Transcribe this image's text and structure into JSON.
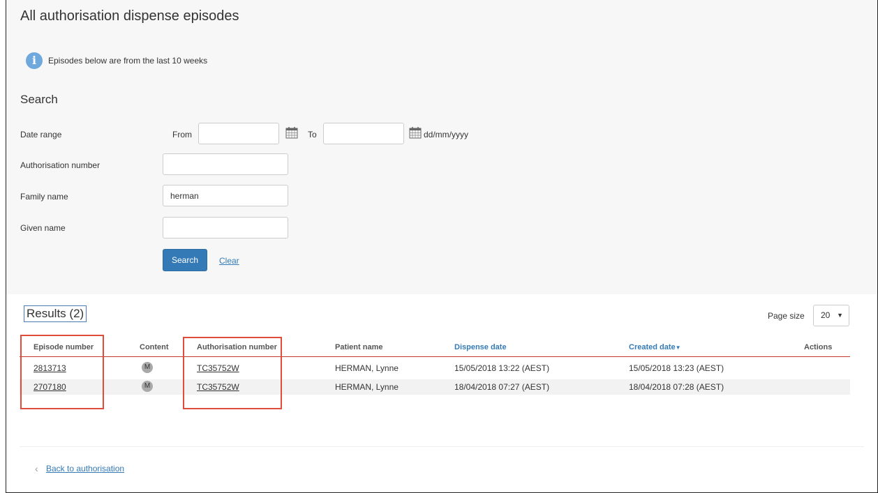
{
  "page": {
    "title": "All authorisation dispense episodes",
    "info_text": "Episodes below are from the last 10 weeks"
  },
  "search": {
    "title": "Search",
    "date_range_label": "Date range",
    "from_label": "From",
    "to_label": "To",
    "date_format_hint": "dd/mm/yyyy",
    "from_value": "",
    "to_value": "",
    "authorisation_number_label": "Authorisation number",
    "authorisation_number_value": "",
    "family_name_label": "Family name",
    "family_name_value": "herman",
    "given_name_label": "Given name",
    "given_name_value": "",
    "search_button_label": "Search",
    "clear_link_label": "Clear"
  },
  "results": {
    "title": "Results (2)",
    "page_size_label": "Page size",
    "page_size_value": "20",
    "columns": {
      "episode_number": "Episode number",
      "content": "Content",
      "authorisation_number": "Authorisation number",
      "patient_name": "Patient name",
      "dispense_date": "Dispense date",
      "created_date": "Created date",
      "actions": "Actions"
    },
    "rows": [
      {
        "episode_number": "2813713",
        "content": "M",
        "authorisation_number": "TC35752W",
        "patient_name": "HERMAN, Lynne",
        "dispense_date": "15/05/2018 13:22 (AEST)",
        "created_date": "15/05/2018 13:23 (AEST)"
      },
      {
        "episode_number": "2707180",
        "content": "M",
        "authorisation_number": "TC35752W",
        "patient_name": "HERMAN, Lynne",
        "dispense_date": "18/04/2018 07:27 (AEST)",
        "created_date": "18/04/2018 07:28 (AEST)"
      }
    ]
  },
  "footer": {
    "back_link_label": "Back to authorisation"
  },
  "colors": {
    "primary": "#337ab7",
    "highlight_box": "#e04b3a",
    "header_rule": "#c0392b"
  },
  "icons": {
    "info": "info-icon",
    "calendar": "calendar-icon",
    "sort": "sort-desc-icon",
    "back": "chevron-left-icon"
  }
}
